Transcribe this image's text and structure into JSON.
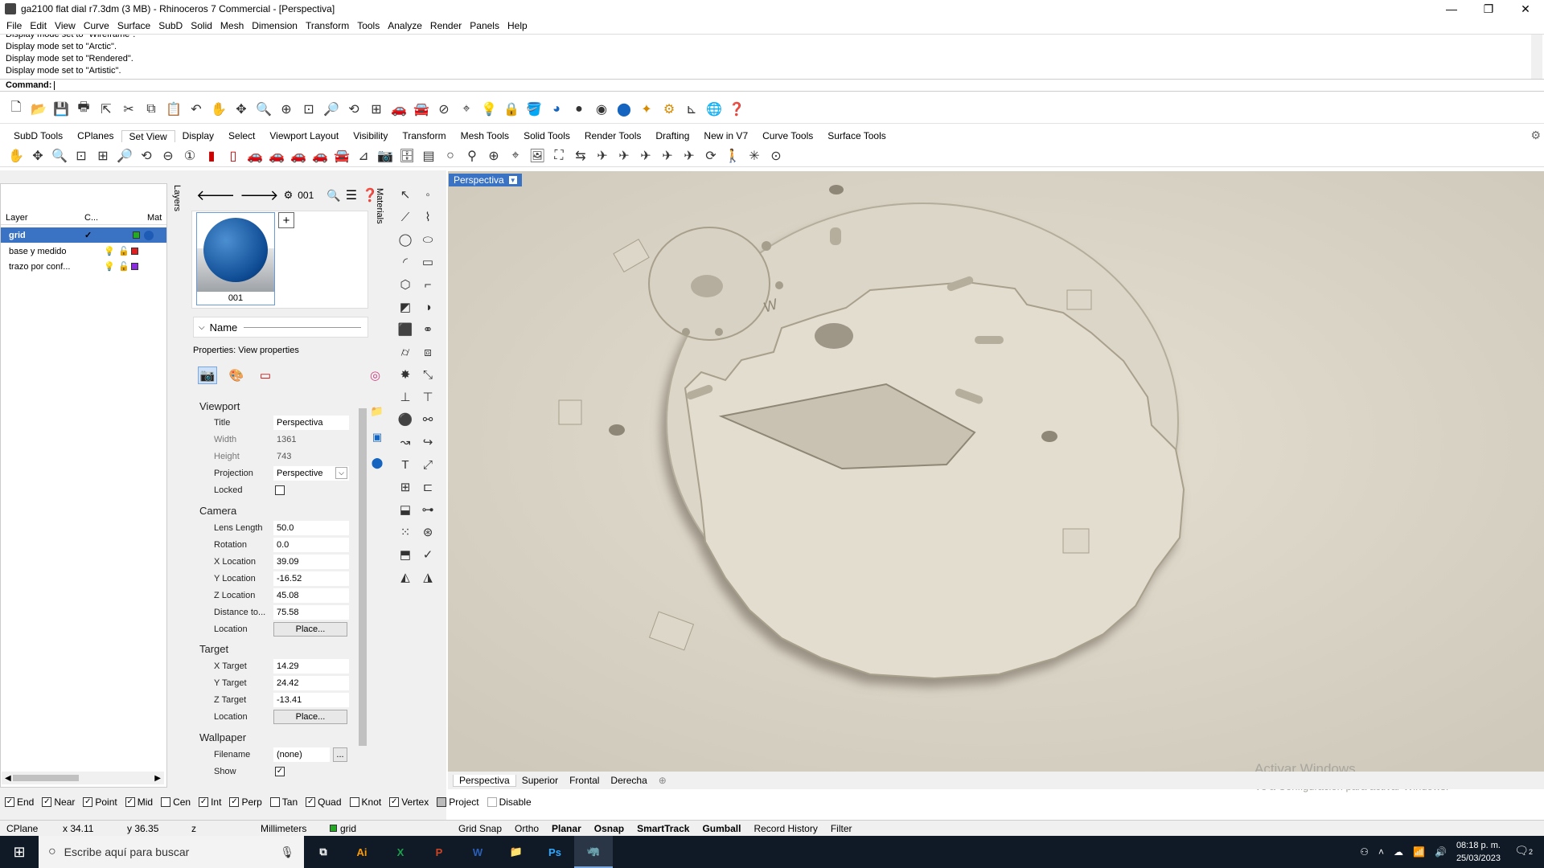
{
  "window": {
    "title": "ga2100 flat dial r7.3dm (3 MB) - Rhinoceros 7 Commercial - [Perspectiva]",
    "min": "—",
    "max": "❐",
    "close": "✕"
  },
  "menu": [
    "File",
    "Edit",
    "View",
    "Curve",
    "Surface",
    "SubD",
    "Solid",
    "Mesh",
    "Dimension",
    "Transform",
    "Tools",
    "Analyze",
    "Render",
    "Panels",
    "Help"
  ],
  "history": [
    "Display mode set to \"Wireframe\".",
    "Display mode set to \"Arctic\".",
    "Display mode set to \"Rendered\".",
    "Display mode set to \"Artistic\"."
  ],
  "command": {
    "label": "Command:"
  },
  "tabs": [
    "SubD Tools",
    "CPlanes",
    "Set View",
    "Display",
    "Select",
    "Viewport Layout",
    "Visibility",
    "Transform",
    "Mesh Tools",
    "Solid Tools",
    "Render Tools",
    "Drafting",
    "New in V7",
    "Curve Tools",
    "Surface Tools"
  ],
  "active_tab": "Set View",
  "layers": {
    "headers": {
      "layer": "Layer",
      "current": "C...",
      "mat": "Mat"
    },
    "rows": [
      {
        "name": "grid",
        "current": "✓",
        "color": "#22aa22",
        "color2": "#1e5bb5"
      },
      {
        "name": "base y medido",
        "color": "#e02020"
      },
      {
        "name": "trazo por conf...",
        "color": "#8a2be2"
      }
    ],
    "vtab": "Layers"
  },
  "materials": {
    "current": "001",
    "thumb_label": "001",
    "name_header": "Name",
    "vtab": "Materials"
  },
  "properties": {
    "title": "Properties: View properties",
    "viewport": {
      "section": "Viewport",
      "title_label": "Title",
      "title": "Perspectiva",
      "width_label": "Width",
      "width": "1361",
      "height_label": "Height",
      "height": "743",
      "projection_label": "Projection",
      "projection": "Perspective",
      "locked_label": "Locked"
    },
    "camera": {
      "section": "Camera",
      "lens_label": "Lens Length",
      "lens": "50.0",
      "rotation_label": "Rotation",
      "rotation": "0.0",
      "xloc_label": "X Location",
      "xloc": "39.09",
      "yloc_label": "Y Location",
      "yloc": "-16.52",
      "zloc_label": "Z Location",
      "zloc": "45.08",
      "dist_label": "Distance to...",
      "dist": "75.58",
      "location_label": "Location",
      "place": "Place..."
    },
    "target": {
      "section": "Target",
      "x_label": "X Target",
      "x": "14.29",
      "y_label": "Y Target",
      "y": "24.42",
      "z_label": "Z Target",
      "z": "-13.41",
      "location_label": "Location",
      "place": "Place..."
    },
    "wallpaper": {
      "section": "Wallpaper",
      "filename_label": "Filename",
      "filename": "(none)",
      "browse": "...",
      "show_label": "Show",
      "show": "✓"
    }
  },
  "viewport": {
    "label": "Perspectiva",
    "tabs": [
      "Perspectiva",
      "Superior",
      "Frontal",
      "Derecha"
    ],
    "add": "⊕"
  },
  "activate": {
    "line1": "Activar Windows",
    "line2": "Ve a Configuración para activar Windows."
  },
  "osnaps": [
    {
      "label": "End",
      "checked": true
    },
    {
      "label": "Near",
      "checked": true
    },
    {
      "label": "Point",
      "checked": true
    },
    {
      "label": "Mid",
      "checked": true
    },
    {
      "label": "Cen",
      "checked": false
    },
    {
      "label": "Int",
      "checked": true
    },
    {
      "label": "Perp",
      "checked": true
    },
    {
      "label": "Tan",
      "checked": false
    },
    {
      "label": "Quad",
      "checked": true
    },
    {
      "label": "Knot",
      "checked": false
    },
    {
      "label": "Vertex",
      "checked": true
    },
    {
      "label": "Project",
      "checked": false
    },
    {
      "label": "Disable",
      "checked": false
    }
  ],
  "status": {
    "cplane": "CPlane",
    "x": "x 34.11",
    "y": "y 36.35",
    "z": "z",
    "units": "Millimeters",
    "layer": "grid",
    "layer_color": "#22aa22",
    "grid_snap": "Grid Snap",
    "ortho": "Ortho",
    "planar": "Planar",
    "osnap": "Osnap",
    "smarttrack": "SmartTrack",
    "gumball": "Gumball",
    "record": "Record History",
    "filter": "Filter"
  },
  "taskbar": {
    "search": "Escribe aquí para buscar",
    "time": "08:18 p. m.",
    "date": "25/03/2023",
    "notif": "2"
  }
}
